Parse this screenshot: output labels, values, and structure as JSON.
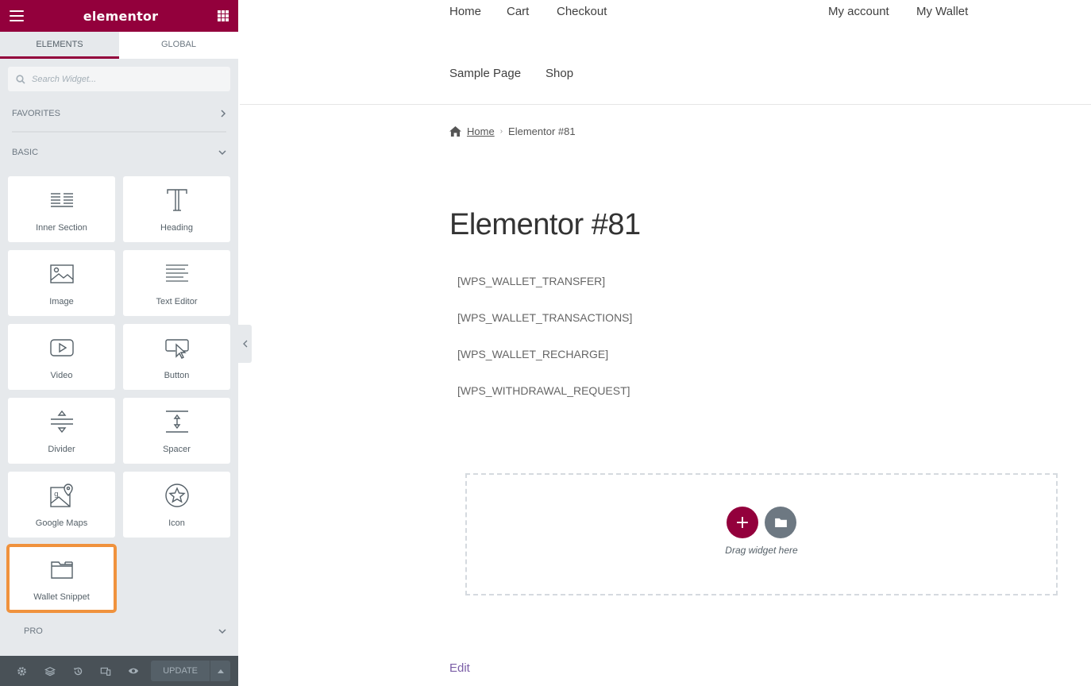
{
  "editor": {
    "logo": "elementor",
    "tabs": [
      {
        "label": "ELEMENTS"
      },
      {
        "label": "GLOBAL"
      }
    ],
    "search": {
      "placeholder": "Search Widget..."
    },
    "categories": {
      "favorites": "FAVORITES",
      "basic": "BASIC",
      "pro": "PRO"
    },
    "widgets": [
      {
        "label": "Inner Section",
        "icon": "inner-section-icon"
      },
      {
        "label": "Heading",
        "icon": "heading-icon"
      },
      {
        "label": "Image",
        "icon": "image-icon"
      },
      {
        "label": "Text Editor",
        "icon": "text-editor-icon"
      },
      {
        "label": "Video",
        "icon": "video-icon"
      },
      {
        "label": "Button",
        "icon": "button-icon"
      },
      {
        "label": "Divider",
        "icon": "divider-icon"
      },
      {
        "label": "Spacer",
        "icon": "spacer-icon"
      },
      {
        "label": "Google Maps",
        "icon": "google-maps-icon"
      },
      {
        "label": "Icon",
        "icon": "star-icon"
      },
      {
        "label": "Wallet Snippet",
        "icon": "folder-icon",
        "highlighted": true
      }
    ],
    "bottom_bar": {
      "update_label": "UPDATE"
    },
    "colors": {
      "brand": "#93003c",
      "highlight": "#f0923d",
      "panel_bg": "#e6e9ec"
    }
  },
  "site": {
    "nav": [
      {
        "label": "Home"
      },
      {
        "label": "Cart"
      },
      {
        "label": "Checkout"
      },
      {
        "label": "My account"
      },
      {
        "label": "My Wallet"
      },
      {
        "label": "Sample Page"
      },
      {
        "label": "Shop"
      }
    ],
    "breadcrumb": {
      "home": "Home",
      "current": "Elementor #81"
    },
    "page_title": "Elementor #81",
    "shortcodes": [
      "[WPS_WALLET_TRANSFER]",
      "[WPS_WALLET_TRANSACTIONS]",
      "[WPS_WALLET_RECHARGE]",
      "[WPS_WITHDRAWAL_REQUEST]"
    ],
    "dropzone": {
      "add_label": "+",
      "text": "Drag widget here"
    },
    "edit_link": "Edit"
  }
}
